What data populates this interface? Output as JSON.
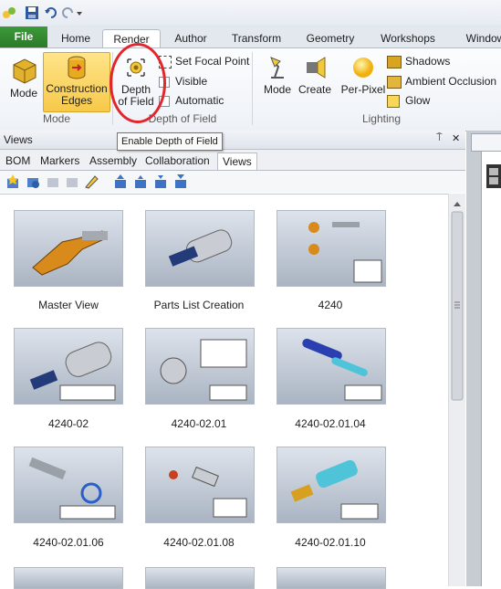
{
  "app": {
    "accent": "#2b7a27",
    "highlight_color": "#e3262b"
  },
  "tabs": [
    "File",
    "Home",
    "Render",
    "Author",
    "Transform",
    "Geometry",
    "Workshops",
    "Window"
  ],
  "ribbon": {
    "mode_group": {
      "mode_label": "Mode",
      "construction_edges_label": "Construction\nEdges",
      "group_label": "Mode"
    },
    "dof_group": {
      "depth_of_field_label": "Depth\nof Field",
      "set_focal_point_label": "Set Focal Point",
      "visible_label": "Visible",
      "automatic_label": "Automatic",
      "group_label": "Depth of Field"
    },
    "lighting_group": {
      "mode_label": "Mode",
      "create_label": "Create",
      "per_pixel_label": "Per-Pixel",
      "shadows_label": "Shadows",
      "ambient_occlusion_label": "Ambient Occlusion",
      "glow_label": "Glow",
      "group_label": "Lighting"
    }
  },
  "tooltip": "Enable Depth of Field",
  "panel": {
    "title": "Views",
    "pin": "⍑",
    "close": "✕",
    "subtabs": [
      "BOM",
      "Markers",
      "Assembly",
      "Collaboration",
      "Views"
    ]
  },
  "views": [
    {
      "label": "Master View"
    },
    {
      "label": "Parts List Creation"
    },
    {
      "label": "4240"
    },
    {
      "label": "4240-02"
    },
    {
      "label": "4240-02.01"
    },
    {
      "label": "4240-02.01.04"
    },
    {
      "label": "4240-02.01.06"
    },
    {
      "label": "4240-02.01.08"
    },
    {
      "label": "4240-02.01.10"
    }
  ]
}
